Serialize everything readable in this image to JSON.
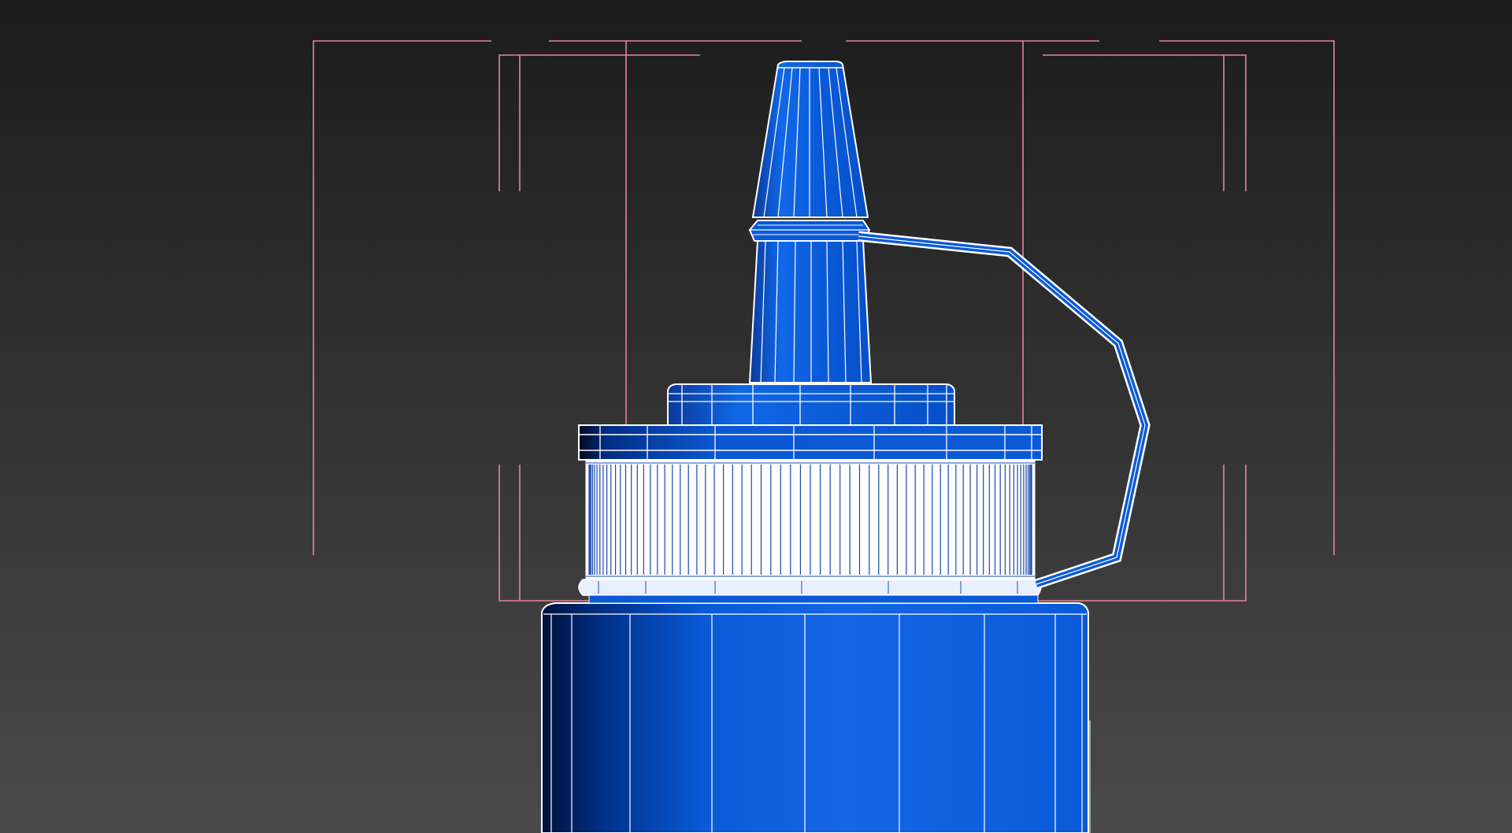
{
  "viewport": {
    "background_top": "#1c1c1c",
    "background_bottom": "#4a4a4a",
    "wireframe_color": "#ffffff",
    "selection_bracket_color": "#e8849b"
  },
  "model": {
    "body_color": "#0a5ad8",
    "body_dark": "#002a78",
    "body_light": "#1870ee",
    "collar_color": "#ffffff"
  }
}
